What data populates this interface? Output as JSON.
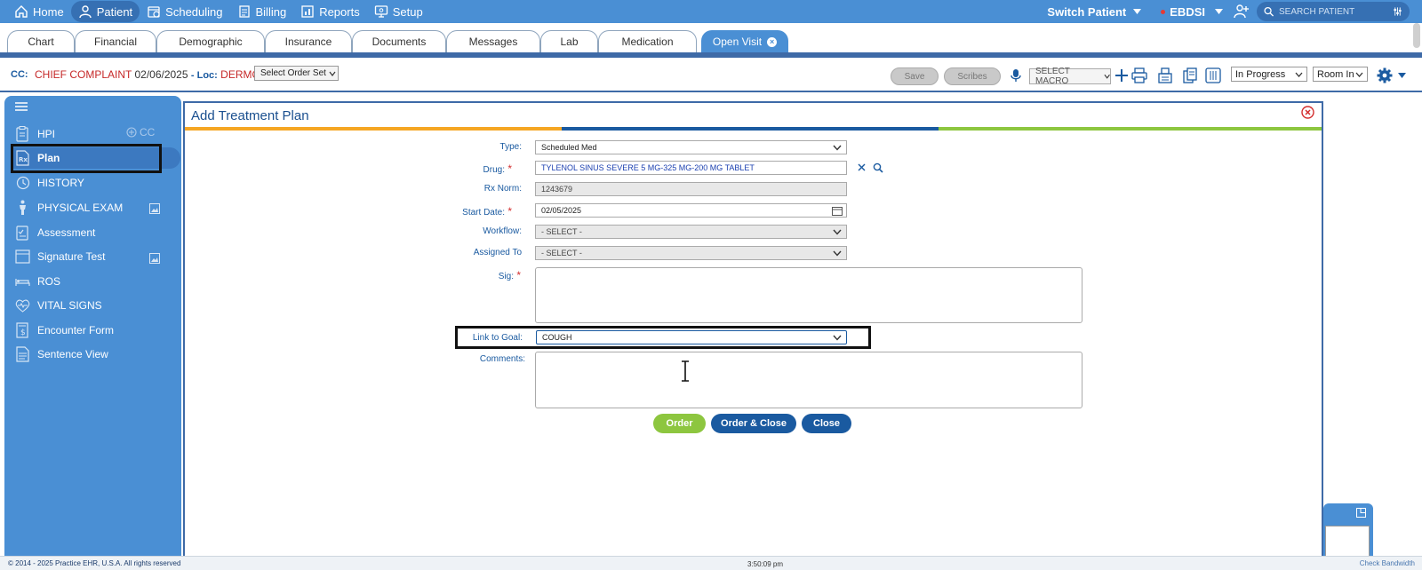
{
  "nav": {
    "items": [
      {
        "label": "Home",
        "icon": "home-icon"
      },
      {
        "label": "Patient",
        "icon": "user-icon"
      },
      {
        "label": "Scheduling",
        "icon": "calendar-icon"
      },
      {
        "label": "Billing",
        "icon": "billing-icon"
      },
      {
        "label": "Reports",
        "icon": "reports-icon"
      },
      {
        "label": "Setup",
        "icon": "setup-icon"
      }
    ],
    "switch_patient": "Switch Patient",
    "facility": "EBDSI",
    "search_placeholder": "SEARCH PATIENT"
  },
  "tabs": [
    "Chart",
    "Financial",
    "Demographic",
    "Insurance",
    "Documents",
    "Messages",
    "Lab",
    "Medication",
    "Open Visit"
  ],
  "toolbar": {
    "cc_label": "CC:",
    "chief_complaint": "CHIEF COMPLAINT",
    "date": "02/06/2025",
    "loc_label": "- Loc:",
    "loc_value": "DERMO",
    "order_set": "Select Order Set",
    "save": "Save",
    "scribes": "Scribes",
    "macro": "SELECT MACRO",
    "status": "In Progress",
    "room": "Room In"
  },
  "sidebar": {
    "add_cc": "CC",
    "items": [
      {
        "label": "HPI"
      },
      {
        "label": "Plan"
      },
      {
        "label": "HISTORY"
      },
      {
        "label": "PHYSICAL EXAM"
      },
      {
        "label": "Assessment"
      },
      {
        "label": "Signature Test"
      },
      {
        "label": "ROS"
      },
      {
        "label": "VITAL SIGNS"
      },
      {
        "label": "Encounter Form"
      },
      {
        "label": "Sentence View"
      }
    ]
  },
  "panel": {
    "title": "Add Treatment Plan",
    "colors": {
      "orange": "#f5a623",
      "blue": "#1a5aa0",
      "green": "#8dc63f"
    },
    "fields": {
      "type_label": "Type:",
      "type_value": "Scheduled Med",
      "drug_label": "Drug:",
      "drug_value": "TYLENOL SINUS SEVERE 5 MG-325 MG-200 MG TABLET",
      "rxnorm_label": "Rx Norm:",
      "rxnorm_value": "1243679",
      "start_label": "Start Date:",
      "start_value": "02/05/2025",
      "workflow_label": "Workflow:",
      "workflow_value": "- SELECT -",
      "assigned_label": "Assigned To",
      "assigned_value": "- SELECT -",
      "sig_label": "Sig:",
      "goal_label": "Link to Goal:",
      "goal_value": "COUGH",
      "comments_label": "Comments:"
    },
    "buttons": {
      "order": "Order",
      "order_close": "Order & Close",
      "close": "Close"
    }
  },
  "footer": {
    "copyright": "© 2014 - 2025 Practice EHR, U.S.A. All rights reserved",
    "time": "3:50:09 pm",
    "bandwidth": "Check Bandwidth"
  }
}
